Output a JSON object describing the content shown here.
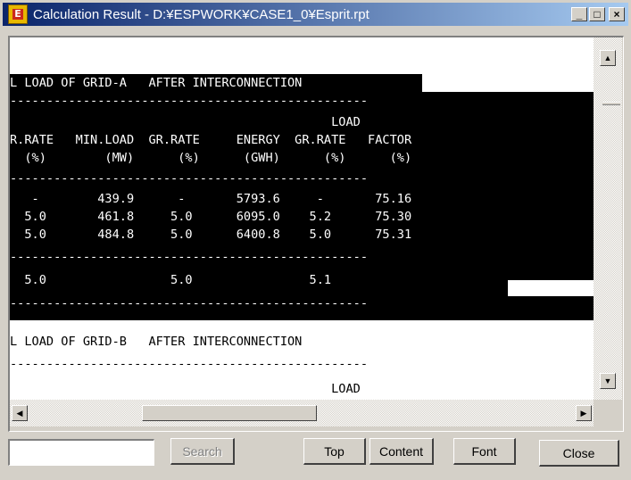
{
  "window": {
    "title": "Calculation Result - D:¥ESPWORK¥CASE1_0¥Esprit.rpt",
    "minimize_glyph": "_",
    "maximize_glyph": "□",
    "close_glyph": "×"
  },
  "report": {
    "lines": [
      "L LOAD OF GRID-A   AFTER INTERCONNECTION ",
      "-------------------------------------------------",
      "                                            LOAD",
      "R.RATE   MIN.LOAD  GR.RATE     ENERGY  GR.RATE   FACTOR",
      "  (%)        (MW)      (%)      (GWH)      (%)      (%)",
      "-------------------------------------------------",
      "   -        439.9      -       5793.6     -       75.16",
      "  5.0       461.8     5.0      6095.0    5.2      75.30",
      "  5.0       484.8     5.0      6400.8    5.0      75.31",
      "-------------------------------------------------",
      "  5.0                 5.0                5.1",
      "-------------------------------------------------",
      "L LOAD OF GRID-B   AFTER INTERCONNECTION",
      "-------------------------------------------------",
      "                                            LOAD"
    ]
  },
  "toolbar": {
    "search_value": "",
    "search_label": "Search",
    "top_label": "Top",
    "content_label": "Content",
    "font_label": "Font",
    "close_label": "Close"
  },
  "scrollbars": {
    "up_glyph": "▲",
    "down_glyph": "▼",
    "left_glyph": "◀",
    "right_glyph": "▶"
  },
  "colors": {
    "titlebar_start": "#0a246a",
    "titlebar_end": "#a6caf0",
    "report_highlight": "#000000",
    "window_face": "#d4d0c8"
  }
}
